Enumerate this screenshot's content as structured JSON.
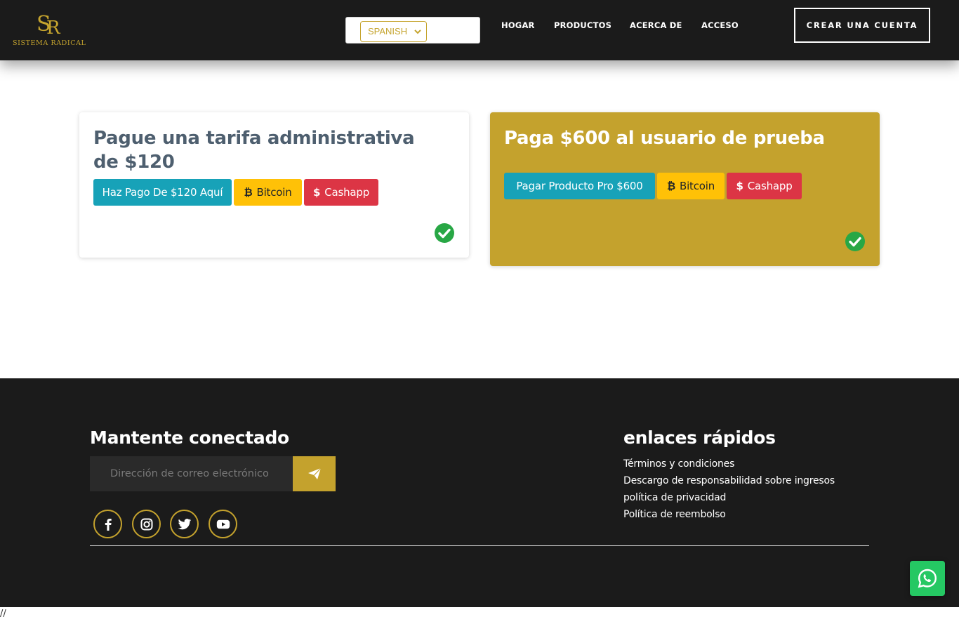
{
  "header": {
    "logo_text": "SISTEMA RADICAL",
    "language_selected": "SPANISH",
    "nav": [
      "HOGAR",
      "PRODUCTOS",
      "ACERCA DE",
      "ACCESO"
    ],
    "cta": "CREAR UNA CUENTA"
  },
  "cards": [
    {
      "title": "Pague una tarifa administrativa de $120",
      "pay_button": "Haz Pago De $120 Aquí",
      "bitcoin_button": "Bitcoin",
      "cashapp_button": "Cashapp",
      "status_icon": "check-circle-icon"
    },
    {
      "title": "Paga $600 al usuario de prueba",
      "pay_button": "Pagar Producto Pro $600",
      "bitcoin_button": "Bitcoin",
      "cashapp_button": "Cashapp",
      "status_icon": "check-circle-icon"
    }
  ],
  "footer": {
    "connect_heading": "Mantente conectado",
    "email_placeholder": "Dirección de correo electrónico",
    "social": [
      "facebook-icon",
      "instagram-icon",
      "twitter-icon",
      "youtube-icon"
    ],
    "links_heading": "enlaces rápidos",
    "links": [
      "Términos y condiciones",
      "Descargo de responsabilidad sobre ingresos",
      "política de privacidad",
      "Política de reembolso"
    ]
  },
  "page_tail": "//",
  "colors": {
    "gold": "#c4a22d",
    "dark": "#1b1b1b",
    "info": "#17a2b8",
    "warning": "#ffc107",
    "danger": "#dc3545",
    "success": "#28a745",
    "whatsapp": "#25c863"
  }
}
